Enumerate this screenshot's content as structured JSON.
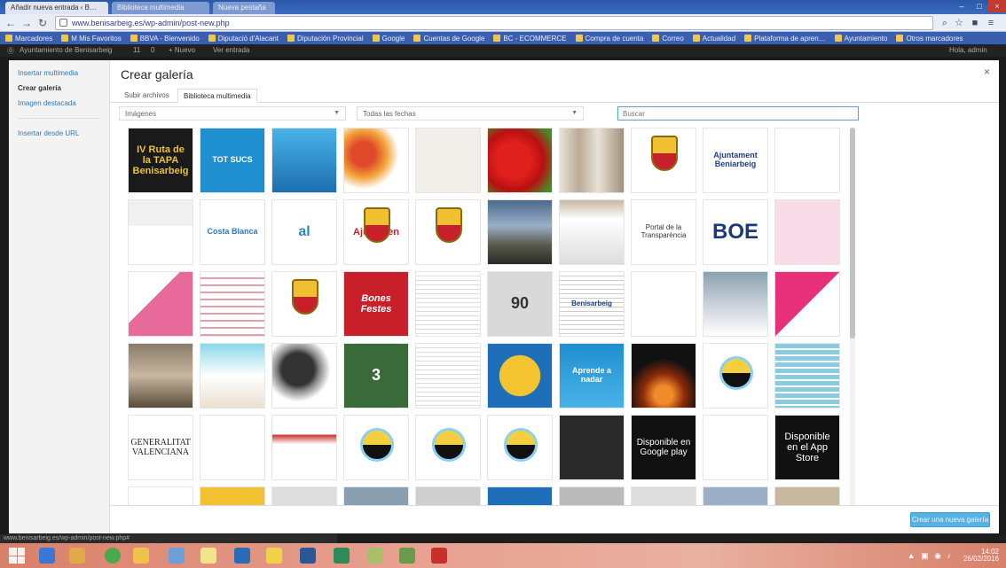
{
  "browser": {
    "tabs": [
      {
        "label": "Añadir nueva entrada ‹ B…"
      },
      {
        "label": "Biblioteca multimedia"
      },
      {
        "label": "Nueva pestaña"
      }
    ],
    "url": "www.benisarbeig.es/wp-admin/post-new.php",
    "bookmarks": [
      "Marcadores",
      "M Mis Favoritos",
      "BBVA - Bienvenido",
      "Diputació d'Alacant",
      "Diputación Provincial",
      "Google",
      "Cuentas de Google",
      "BC - ECOMMERCE",
      "Compra de cuenta",
      "Correo",
      "Actualidad",
      "Plataforma de apren…",
      "Ayuntamiento",
      "Otros marcadores"
    ],
    "status_url": "www.benisarbeig.es/wp-admin/post-new.php#"
  },
  "wp_admin_bar": {
    "items": [
      "Ayuntamiento de Benisarbeig",
      "11",
      "0",
      "+ Nuevo",
      "Ver entrada",
      "Hola, admin"
    ]
  },
  "modal": {
    "title": "Crear galería",
    "close_label": "×",
    "sidebar": {
      "items": [
        {
          "label": "Insertar multimedia",
          "active": false
        },
        {
          "label": "Crear galería",
          "active": true
        },
        {
          "label": "Imagen destacada",
          "active": false
        }
      ],
      "secondary": [
        {
          "label": "Insertar desde URL"
        }
      ]
    },
    "router": {
      "tabs": [
        {
          "label": "Subir archivos",
          "active": false
        },
        {
          "label": "Biblioteca multimedia",
          "active": true
        }
      ]
    },
    "filters": {
      "type_filter": "Imágenes",
      "date_filter": "Todas las fechas",
      "search_placeholder": "Buscar"
    },
    "footer": {
      "primary_button": "Crear una nueva galería"
    }
  },
  "thumbnails": [
    {
      "name": "ruta-tapa-poster",
      "text": "IV Ruta de la TAPA Benisarbeig"
    },
    {
      "name": "tot-sucs-poster",
      "text": "TOT SUCS"
    },
    {
      "name": "fish-sea-blue",
      "text": ""
    },
    {
      "name": "vegetables",
      "text": ""
    },
    {
      "name": "map-sketch",
      "text": ""
    },
    {
      "name": "strawberries",
      "text": ""
    },
    {
      "name": "building-facade",
      "text": ""
    },
    {
      "name": "coat-of-arms-1",
      "text": ""
    },
    {
      "name": "ajuntament-beniarbeig-logo",
      "text": "Ajuntament Beniarbeig"
    },
    {
      "name": "diputacion-logo",
      "text": ""
    },
    {
      "name": "banner-blank",
      "text": ""
    },
    {
      "name": "costa-blanca-logo",
      "text": "Costa Blanca"
    },
    {
      "name": "al-logo",
      "text": "al"
    },
    {
      "name": "coat-of-arms-ajuntament",
      "text": "Ajunt Ben"
    },
    {
      "name": "coat-of-arms-2",
      "text": ""
    },
    {
      "name": "mountain-landscape",
      "text": ""
    },
    {
      "name": "newspaper-clip",
      "text": ""
    },
    {
      "name": "portal-transparencia",
      "text": "Portal de la Transparència"
    },
    {
      "name": "boe-logo",
      "text": "BOE"
    },
    {
      "name": "pink-document",
      "text": ""
    },
    {
      "name": "pink-poster",
      "text": ""
    },
    {
      "name": "calendar-grid",
      "text": ""
    },
    {
      "name": "coat-of-arms-3",
      "text": ""
    },
    {
      "name": "bones-festes",
      "text": "Bones Festes"
    },
    {
      "name": "document-red",
      "text": ""
    },
    {
      "name": "speed-90",
      "text": "90"
    },
    {
      "name": "benisarbeig-doc",
      "text": "Benisarbeig"
    },
    {
      "name": "text-doc",
      "text": ""
    },
    {
      "name": "people-photo",
      "text": ""
    },
    {
      "name": "pink-poster-2",
      "text": ""
    },
    {
      "name": "old-street",
      "text": ""
    },
    {
      "name": "curs-poster",
      "text": ""
    },
    {
      "name": "tires",
      "text": ""
    },
    {
      "name": "green-poster",
      "text": "3"
    },
    {
      "name": "document-red-2",
      "text": ""
    },
    {
      "name": "sun-sunglasses",
      "text": ""
    },
    {
      "name": "aprende-nadar",
      "text": "Aprende a nadar"
    },
    {
      "name": "fire-night",
      "text": ""
    },
    {
      "name": "circle-logo-1",
      "text": ""
    },
    {
      "name": "blue-doc",
      "text": ""
    },
    {
      "name": "generalitat-valenciana",
      "text": "GENERALITAT VALENCIANA"
    },
    {
      "name": "text-banner",
      "text": ""
    },
    {
      "name": "red-doc",
      "text": ""
    },
    {
      "name": "circle-logo-2",
      "text": ""
    },
    {
      "name": "circle-logo-3",
      "text": ""
    },
    {
      "name": "circle-logo-4",
      "text": ""
    },
    {
      "name": "chalkboard",
      "text": ""
    },
    {
      "name": "google-play-badge",
      "text": "Disponible en Google play"
    },
    {
      "name": "blank-doc",
      "text": ""
    },
    {
      "name": "app-store-badge",
      "text": "Disponible en el App Store"
    }
  ],
  "taskbar": {
    "time": "14:02",
    "date": "26/02/2016"
  },
  "colors": {
    "wp_primary": "#5ab0e0",
    "link": "#2e7bb8",
    "search_focus": "#5b9dd9"
  }
}
